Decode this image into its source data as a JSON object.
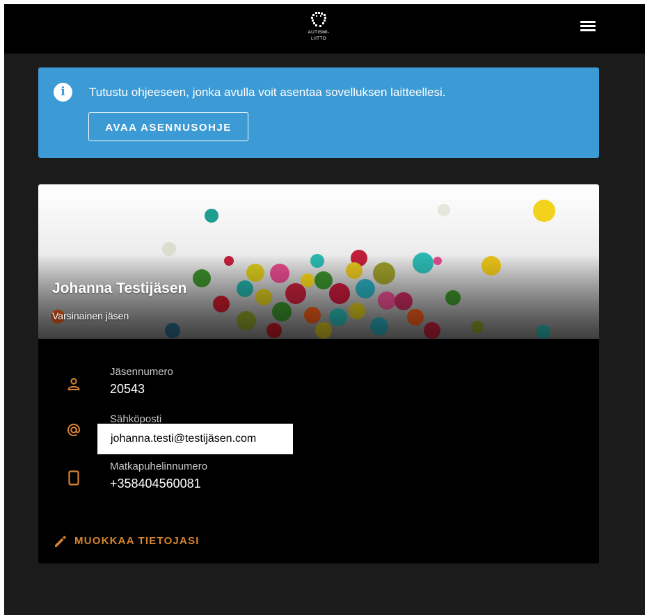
{
  "header": {
    "logo_text_line1": "AUTISMI-",
    "logo_text_line2": "LIITTO",
    "logo_icon": "autismiliitto-logo",
    "menu_icon": "hamburger-menu-icon"
  },
  "banner": {
    "icon": "info-icon",
    "message": "Tutustu ohjeeseen, jonka avulla voit asentaa sovelluksen laitteellesi.",
    "button_label": "AVAA ASENNUSOHJE",
    "background_color": "#3c9ad4"
  },
  "member": {
    "name": "Johanna Testijäsen",
    "membership_type": "Varsinainen jäsen",
    "fields": [
      {
        "icon": "person-icon",
        "label": "Jäsennumero",
        "value": "20543"
      },
      {
        "icon": "at-sign-icon",
        "label": "Sähköposti",
        "value": "johanna.testi@testijäsen.com"
      },
      {
        "icon": "phone-icon",
        "label": "Matkapuhelinnumero",
        "value": "+358404560081"
      }
    ],
    "edit_label": "MUOKKAA TIETOJASI",
    "edit_icon": "pencil-icon",
    "accent_color": "#d8852f"
  }
}
